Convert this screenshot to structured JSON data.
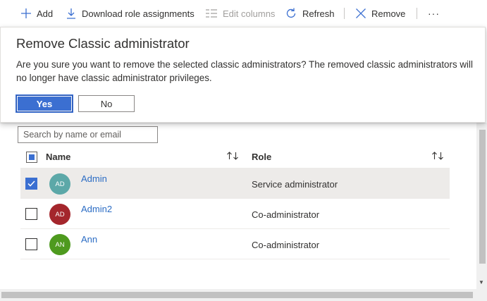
{
  "toolbar": {
    "add_label": "Add",
    "download_label": "Download role assignments",
    "edit_columns_label": "Edit columns",
    "refresh_label": "Refresh",
    "remove_label": "Remove",
    "more_label": "···"
  },
  "dialog": {
    "title": "Remove Classic administrator",
    "message": "Are you sure you want to remove the selected classic administrators? The removed classic administrators will no longer have classic administrator privileges.",
    "yes_label": "Yes",
    "no_label": "No"
  },
  "search": {
    "placeholder": "Search by name or email"
  },
  "table": {
    "columns": [
      "Name",
      "Role"
    ],
    "rows": [
      {
        "initials": "AD",
        "name": "Admin",
        "role": "Service administrator",
        "checked": true,
        "avatar_color": "#5ca8a8"
      },
      {
        "initials": "AD",
        "name": "Admin2",
        "role": "Co-administrator",
        "checked": false,
        "avatar_color": "#a4262c"
      },
      {
        "initials": "AN",
        "name": "Ann",
        "role": "Co-administrator",
        "checked": false,
        "avatar_color": "#4e9a1e"
      }
    ]
  },
  "colors": {
    "accent": "#3b6fd1",
    "link": "#2b6cc4"
  }
}
